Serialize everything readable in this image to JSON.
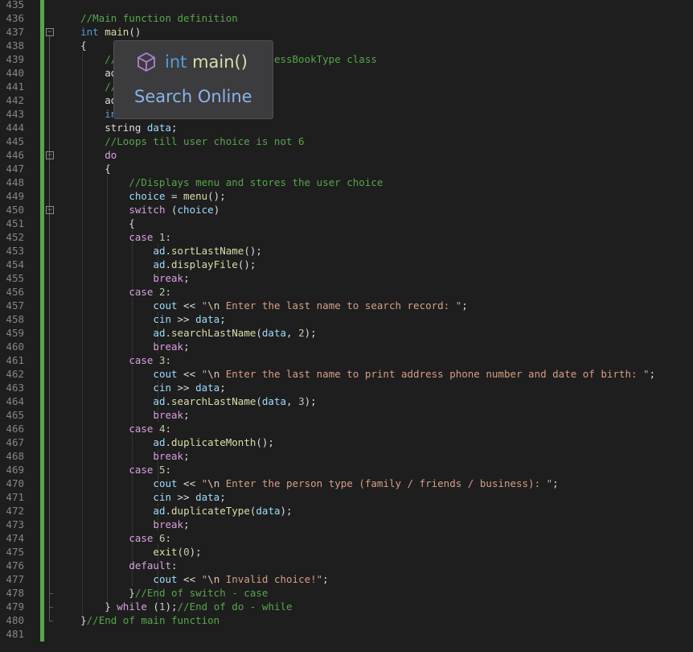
{
  "lines": [
    {
      "n": "435",
      "t": []
    },
    {
      "n": "436",
      "t": [
        [
          "    //Main function definition",
          "com"
        ]
      ]
    },
    {
      "n": "437",
      "t": [
        [
          "    ",
          "pl"
        ],
        [
          "int",
          "kw"
        ],
        [
          " ",
          "pl"
        ],
        [
          "main",
          "fn"
        ],
        [
          "()",
          "pl"
        ]
      ]
    },
    {
      "n": "438",
      "t": [
        [
          "    {",
          "pl"
        ]
      ]
    },
    {
      "n": "439",
      "t": [
        [
          "        //",
          "com"
        ],
        [
          "                          ",
          "pl"
        ],
        [
          "essBookType class",
          "com"
        ]
      ]
    },
    {
      "n": "440",
      "t": [
        [
          "        ad",
          "pl"
        ]
      ]
    },
    {
      "n": "441",
      "t": [
        [
          "        //",
          "com"
        ]
      ]
    },
    {
      "n": "442",
      "t": [
        [
          "        ad",
          "pl"
        ]
      ]
    },
    {
      "n": "443",
      "t": [
        [
          "        in",
          "kw"
        ]
      ]
    },
    {
      "n": "444",
      "t": [
        [
          "        ",
          "pl"
        ],
        [
          "string",
          "pl"
        ],
        [
          " ",
          "pl"
        ],
        [
          "data",
          "var"
        ],
        [
          ";",
          "pl"
        ]
      ]
    },
    {
      "n": "445",
      "t": [
        [
          "        //Loops till user choice is not 6",
          "com"
        ]
      ]
    },
    {
      "n": "446",
      "t": [
        [
          "        ",
          "pl"
        ],
        [
          "do",
          "ctrl"
        ]
      ]
    },
    {
      "n": "447",
      "t": [
        [
          "        {",
          "pl"
        ]
      ]
    },
    {
      "n": "448",
      "t": [
        [
          "            //Displays menu and stores the user choice",
          "com"
        ]
      ]
    },
    {
      "n": "449",
      "t": [
        [
          "            ",
          "pl"
        ],
        [
          "choice",
          "var"
        ],
        [
          " = ",
          "pl"
        ],
        [
          "menu",
          "fn"
        ],
        [
          "();",
          "pl"
        ]
      ]
    },
    {
      "n": "450",
      "t": [
        [
          "            ",
          "pl"
        ],
        [
          "switch",
          "ctrl"
        ],
        [
          " (",
          "pl"
        ],
        [
          "choice",
          "var"
        ],
        [
          ")",
          "pl"
        ]
      ]
    },
    {
      "n": "451",
      "t": [
        [
          "            {",
          "pl"
        ]
      ]
    },
    {
      "n": "452",
      "t": [
        [
          "            ",
          "pl"
        ],
        [
          "case",
          "ctrl"
        ],
        [
          " ",
          "pl"
        ],
        [
          "1",
          "num"
        ],
        [
          ":",
          "pl"
        ]
      ]
    },
    {
      "n": "453",
      "t": [
        [
          "                ",
          "pl"
        ],
        [
          "ad",
          "var"
        ],
        [
          ".",
          "pl"
        ],
        [
          "sortLastName",
          "fn"
        ],
        [
          "();",
          "pl"
        ]
      ]
    },
    {
      "n": "454",
      "t": [
        [
          "                ",
          "pl"
        ],
        [
          "ad",
          "var"
        ],
        [
          ".",
          "pl"
        ],
        [
          "displayFile",
          "fn"
        ],
        [
          "();",
          "pl"
        ]
      ]
    },
    {
      "n": "455",
      "t": [
        [
          "                ",
          "pl"
        ],
        [
          "break",
          "ctrl"
        ],
        [
          ";",
          "pl"
        ]
      ]
    },
    {
      "n": "456",
      "t": [
        [
          "            ",
          "pl"
        ],
        [
          "case",
          "ctrl"
        ],
        [
          " ",
          "pl"
        ],
        [
          "2",
          "num"
        ],
        [
          ":",
          "pl"
        ]
      ]
    },
    {
      "n": "457",
      "t": [
        [
          "                ",
          "pl"
        ],
        [
          "cout",
          "var"
        ],
        [
          " << ",
          "pl"
        ],
        [
          "\"",
          "str"
        ],
        [
          "\\n",
          "esc"
        ],
        [
          " Enter the last name to search record: \"",
          "str"
        ],
        [
          ";",
          "pl"
        ]
      ]
    },
    {
      "n": "458",
      "t": [
        [
          "                ",
          "pl"
        ],
        [
          "cin",
          "var"
        ],
        [
          " >> ",
          "pl"
        ],
        [
          "data",
          "var"
        ],
        [
          ";",
          "pl"
        ]
      ]
    },
    {
      "n": "459",
      "t": [
        [
          "                ",
          "pl"
        ],
        [
          "ad",
          "var"
        ],
        [
          ".",
          "pl"
        ],
        [
          "searchLastName",
          "fn"
        ],
        [
          "(",
          "pl"
        ],
        [
          "data",
          "var"
        ],
        [
          ", ",
          "pl"
        ],
        [
          "2",
          "num"
        ],
        [
          ");",
          "pl"
        ]
      ]
    },
    {
      "n": "460",
      "t": [
        [
          "                ",
          "pl"
        ],
        [
          "break",
          "ctrl"
        ],
        [
          ";",
          "pl"
        ]
      ]
    },
    {
      "n": "461",
      "t": [
        [
          "            ",
          "pl"
        ],
        [
          "case",
          "ctrl"
        ],
        [
          " ",
          "pl"
        ],
        [
          "3",
          "num"
        ],
        [
          ":",
          "pl"
        ]
      ]
    },
    {
      "n": "462",
      "t": [
        [
          "                ",
          "pl"
        ],
        [
          "cout",
          "var"
        ],
        [
          " << ",
          "pl"
        ],
        [
          "\"",
          "str"
        ],
        [
          "\\n",
          "esc"
        ],
        [
          " Enter the last name to print address phone number and date of birth: \"",
          "str"
        ],
        [
          ";",
          "pl"
        ]
      ]
    },
    {
      "n": "463",
      "t": [
        [
          "                ",
          "pl"
        ],
        [
          "cin",
          "var"
        ],
        [
          " >> ",
          "pl"
        ],
        [
          "data",
          "var"
        ],
        [
          ";",
          "pl"
        ]
      ]
    },
    {
      "n": "464",
      "t": [
        [
          "                ",
          "pl"
        ],
        [
          "ad",
          "var"
        ],
        [
          ".",
          "pl"
        ],
        [
          "searchLastName",
          "fn"
        ],
        [
          "(",
          "pl"
        ],
        [
          "data",
          "var"
        ],
        [
          ", ",
          "pl"
        ],
        [
          "3",
          "num"
        ],
        [
          ");",
          "pl"
        ]
      ]
    },
    {
      "n": "465",
      "t": [
        [
          "                ",
          "pl"
        ],
        [
          "break",
          "ctrl"
        ],
        [
          ";",
          "pl"
        ]
      ]
    },
    {
      "n": "466",
      "t": [
        [
          "            ",
          "pl"
        ],
        [
          "case",
          "ctrl"
        ],
        [
          " ",
          "pl"
        ],
        [
          "4",
          "num"
        ],
        [
          ":",
          "pl"
        ]
      ]
    },
    {
      "n": "467",
      "t": [
        [
          "                ",
          "pl"
        ],
        [
          "ad",
          "var"
        ],
        [
          ".",
          "pl"
        ],
        [
          "duplicateMonth",
          "fn"
        ],
        [
          "();",
          "pl"
        ]
      ]
    },
    {
      "n": "468",
      "t": [
        [
          "                ",
          "pl"
        ],
        [
          "break",
          "ctrl"
        ],
        [
          ";",
          "pl"
        ]
      ]
    },
    {
      "n": "469",
      "t": [
        [
          "            ",
          "pl"
        ],
        [
          "case",
          "ctrl"
        ],
        [
          " ",
          "pl"
        ],
        [
          "5",
          "num"
        ],
        [
          ":",
          "pl"
        ]
      ]
    },
    {
      "n": "470",
      "t": [
        [
          "                ",
          "pl"
        ],
        [
          "cout",
          "var"
        ],
        [
          " << ",
          "pl"
        ],
        [
          "\"",
          "str"
        ],
        [
          "\\n",
          "esc"
        ],
        [
          " Enter the person type (family / friends / business): \"",
          "str"
        ],
        [
          ";",
          "pl"
        ]
      ]
    },
    {
      "n": "471",
      "t": [
        [
          "                ",
          "pl"
        ],
        [
          "cin",
          "var"
        ],
        [
          " >> ",
          "pl"
        ],
        [
          "data",
          "var"
        ],
        [
          ";",
          "pl"
        ]
      ]
    },
    {
      "n": "472",
      "t": [
        [
          "                ",
          "pl"
        ],
        [
          "ad",
          "var"
        ],
        [
          ".",
          "pl"
        ],
        [
          "duplicateType",
          "fn"
        ],
        [
          "(",
          "pl"
        ],
        [
          "data",
          "var"
        ],
        [
          ");",
          "pl"
        ]
      ]
    },
    {
      "n": "473",
      "t": [
        [
          "                ",
          "pl"
        ],
        [
          "break",
          "ctrl"
        ],
        [
          ";",
          "pl"
        ]
      ]
    },
    {
      "n": "474",
      "t": [
        [
          "            ",
          "pl"
        ],
        [
          "case",
          "ctrl"
        ],
        [
          " ",
          "pl"
        ],
        [
          "6",
          "num"
        ],
        [
          ":",
          "pl"
        ]
      ]
    },
    {
      "n": "475",
      "t": [
        [
          "                ",
          "pl"
        ],
        [
          "exit",
          "fn"
        ],
        [
          "(",
          "pl"
        ],
        [
          "0",
          "num"
        ],
        [
          ");",
          "pl"
        ]
      ]
    },
    {
      "n": "476",
      "t": [
        [
          "            ",
          "pl"
        ],
        [
          "default",
          "ctrl"
        ],
        [
          ":",
          "pl"
        ]
      ]
    },
    {
      "n": "477",
      "t": [
        [
          "                ",
          "pl"
        ],
        [
          "cout",
          "var"
        ],
        [
          " << ",
          "pl"
        ],
        [
          "\"",
          "str"
        ],
        [
          "\\n",
          "esc"
        ],
        [
          " Invalid choice!\"",
          "str"
        ],
        [
          ";",
          "pl"
        ]
      ]
    },
    {
      "n": "478",
      "t": [
        [
          "            }",
          "pl"
        ],
        [
          "//End of switch - case",
          "com"
        ]
      ]
    },
    {
      "n": "479",
      "t": [
        [
          "        } ",
          "pl"
        ],
        [
          "while",
          "ctrl"
        ],
        [
          " (",
          "pl"
        ],
        [
          "1",
          "num"
        ],
        [
          ");",
          "pl"
        ],
        [
          "//End of do - while",
          "com"
        ]
      ]
    },
    {
      "n": "480",
      "t": [
        [
          "    }",
          "pl"
        ],
        [
          "//End of main function",
          "com"
        ]
      ]
    },
    {
      "n": "481",
      "t": []
    }
  ],
  "popup": {
    "icon": "cube-icon",
    "signature_type": "int",
    "signature_name": "main()",
    "search_label": "Search Online"
  },
  "colors": {
    "background": "#1e1e1e",
    "change_bar": "#57a64a",
    "popup_bg": "#3c3c3e",
    "cube_icon": "#b180d7"
  }
}
